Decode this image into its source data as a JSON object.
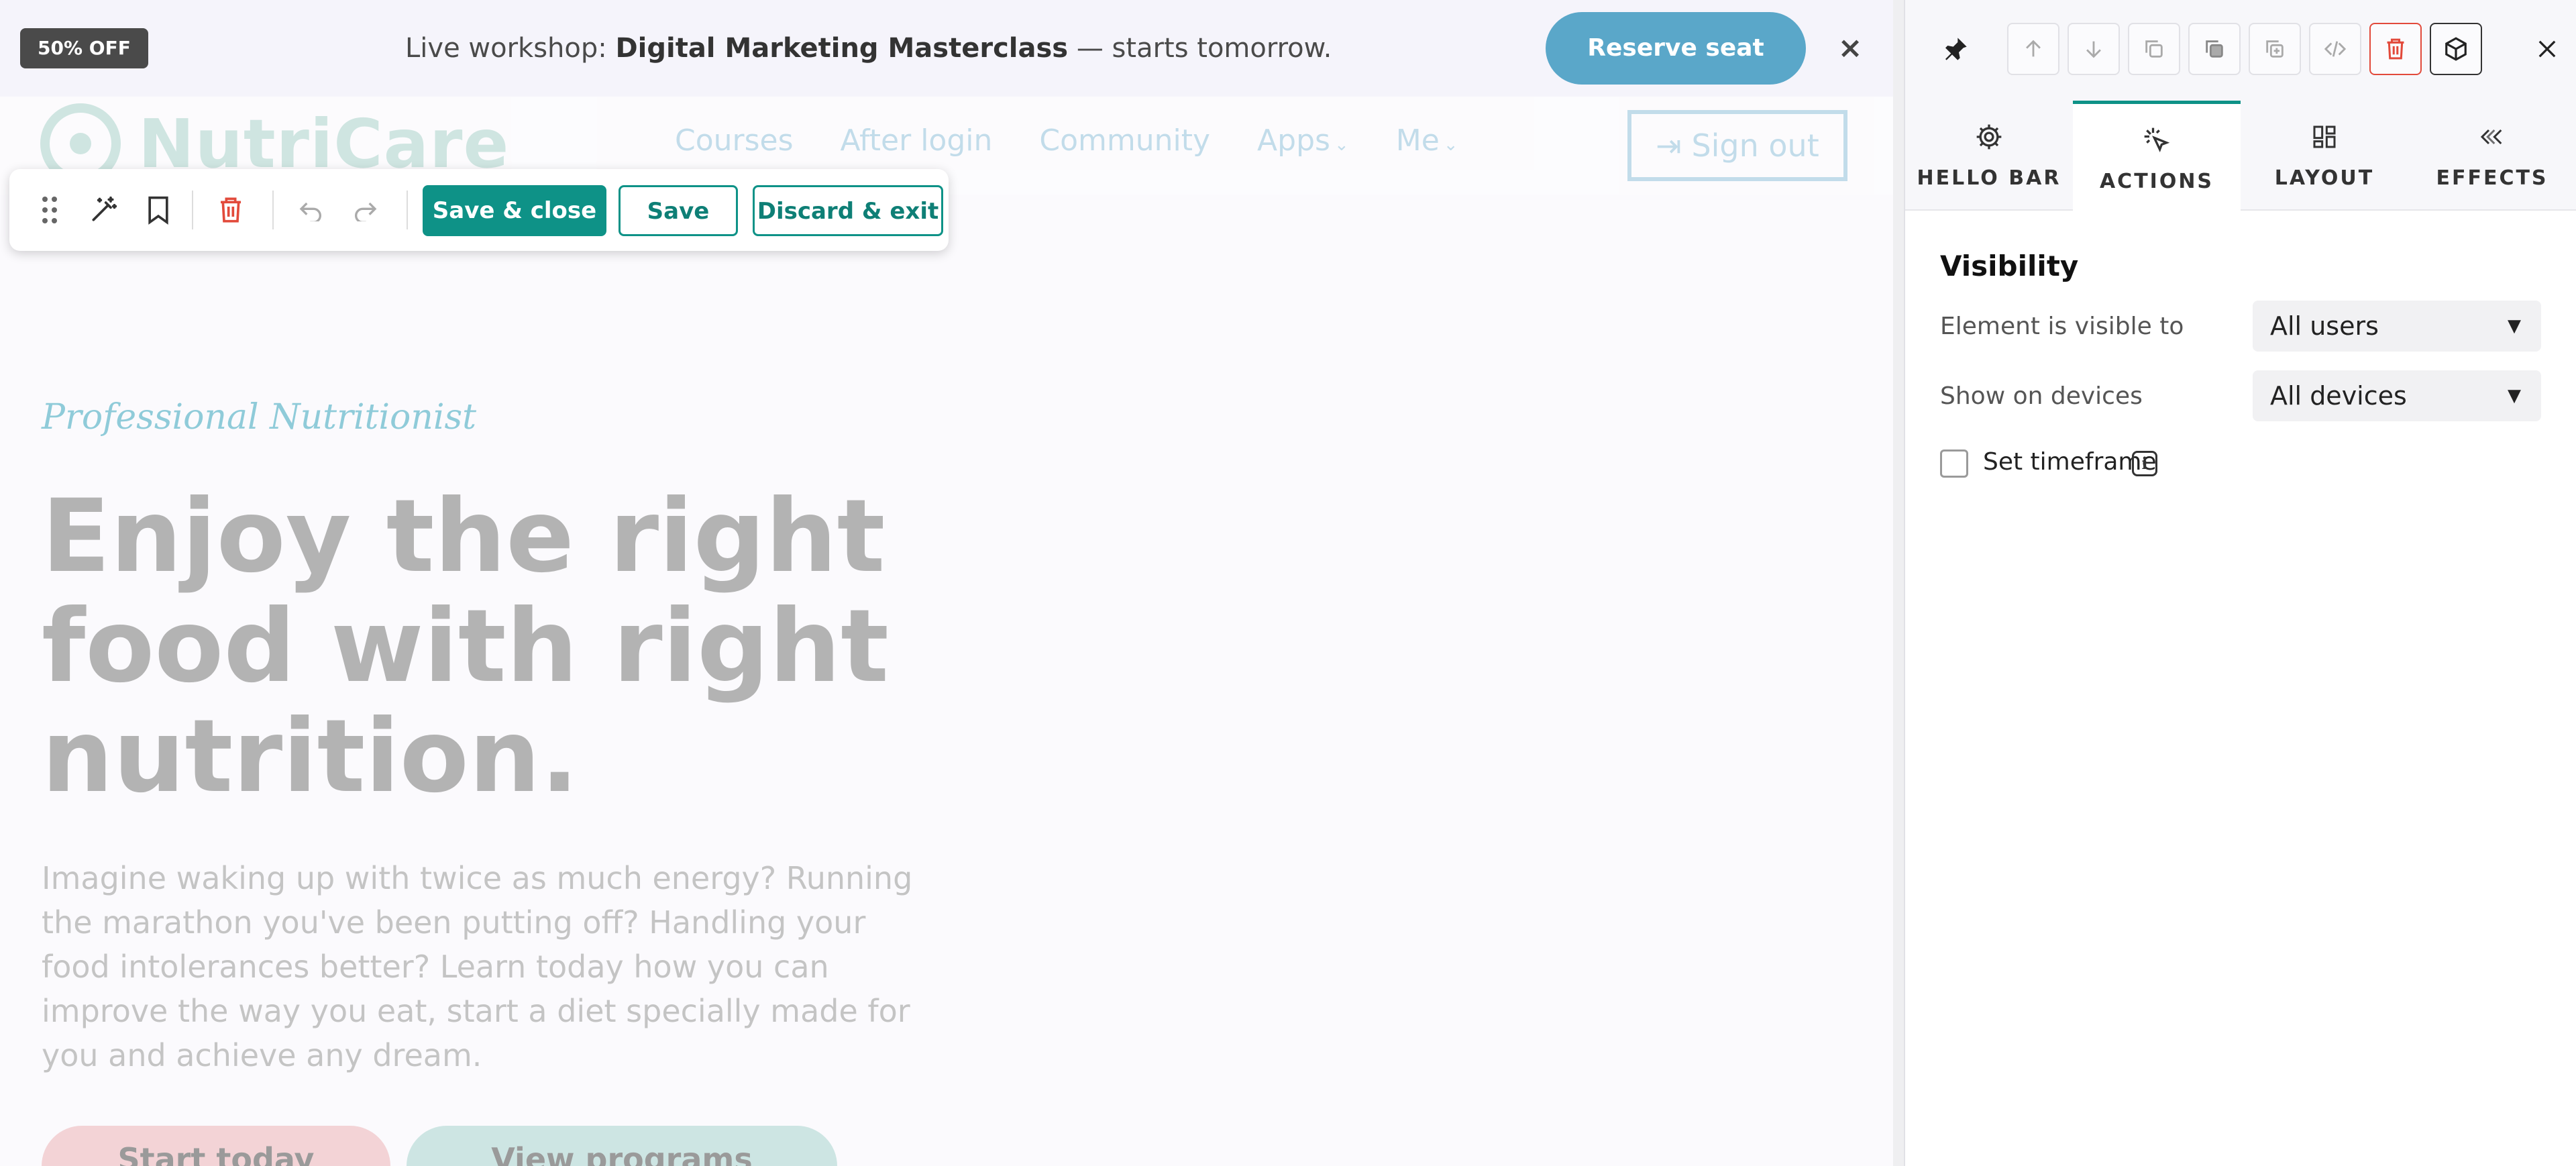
{
  "hello_bar": {
    "badge": "50% OFF",
    "text_prefix": "Live workshop: ",
    "text_strong": "Digital Marketing Masterclass",
    "text_suffix": " — starts tomorrow.",
    "cta": "Reserve seat",
    "close": "×"
  },
  "site": {
    "logo": "NutriCare",
    "nav": [
      "Courses",
      "After login",
      "Community",
      "Apps",
      "Me"
    ],
    "signout": "Sign out",
    "eyebrow": "Professional Nutritionist",
    "title": "Enjoy the right food with right nutrition.",
    "copy": "Imagine waking up with twice as much energy? Running the marathon you've been putting off? Handling your food intolerances better? Learn today how you can improve the way you eat, start a diet specially made for you and achieve any dream.",
    "btn_primary": "Start today",
    "btn_secondary": "View programs"
  },
  "toolbar": {
    "save_close": "Save & close",
    "save": "Save",
    "discard": "Discard & exit",
    "accent": "#0e9287"
  },
  "panel": {
    "tabs": [
      "HELLO BAR",
      "ACTIONS",
      "LAYOUT",
      "EFFECTS"
    ],
    "active_tab": "ACTIONS",
    "section_title": "Visibility",
    "visible_label": "Element is visible to",
    "visible_value": "All users",
    "devices_label": "Show on devices",
    "devices_value": "All devices",
    "timeframe_label": "Set timeframe",
    "timeframe_checked": false,
    "delete_color": "#e24a3b"
  }
}
